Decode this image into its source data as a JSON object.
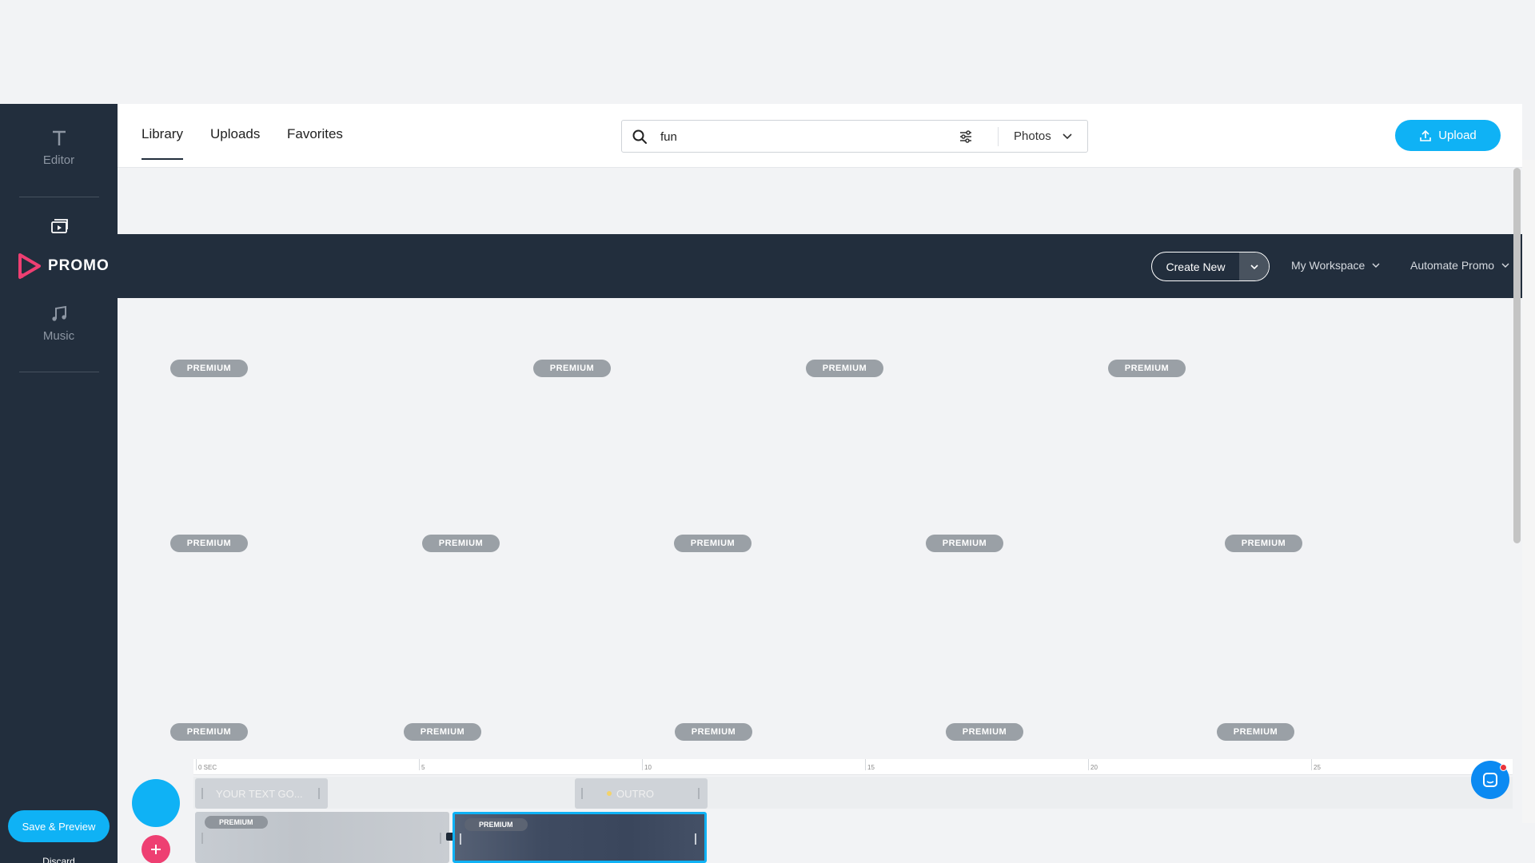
{
  "sidebar": {
    "items": [
      {
        "label": "Editor",
        "icon": "text-icon"
      },
      {
        "label": "",
        "icon": "media-icon"
      },
      {
        "label": "Music",
        "icon": "music-icon"
      }
    ],
    "save_label": "Save & Preview",
    "discard_label": "Discard"
  },
  "library": {
    "tabs": [
      {
        "label": "Library",
        "active": true
      },
      {
        "label": "Uploads",
        "active": false
      },
      {
        "label": "Favorites",
        "active": false
      }
    ],
    "search_value": "fun",
    "media_type": "Photos",
    "upload_label": "Upload"
  },
  "appbar": {
    "logo_text": "PROMO",
    "create_new_label": "Create New",
    "workspace_label": "My Workspace",
    "automate_label": "Automate Promo"
  },
  "grid": {
    "badge_label": "PREMIUM"
  },
  "timeline": {
    "ticks": [
      "0 SEC",
      "5",
      "10",
      "15",
      "20",
      "25"
    ],
    "text_clip_label": "YOUR TEXT GO...",
    "outro_label": "OUTRO",
    "media_badge_label": "PREMIUM"
  },
  "colors": {
    "accent": "#0fb2f5",
    "dark": "#222e3d",
    "brand": "#ee3f72"
  }
}
